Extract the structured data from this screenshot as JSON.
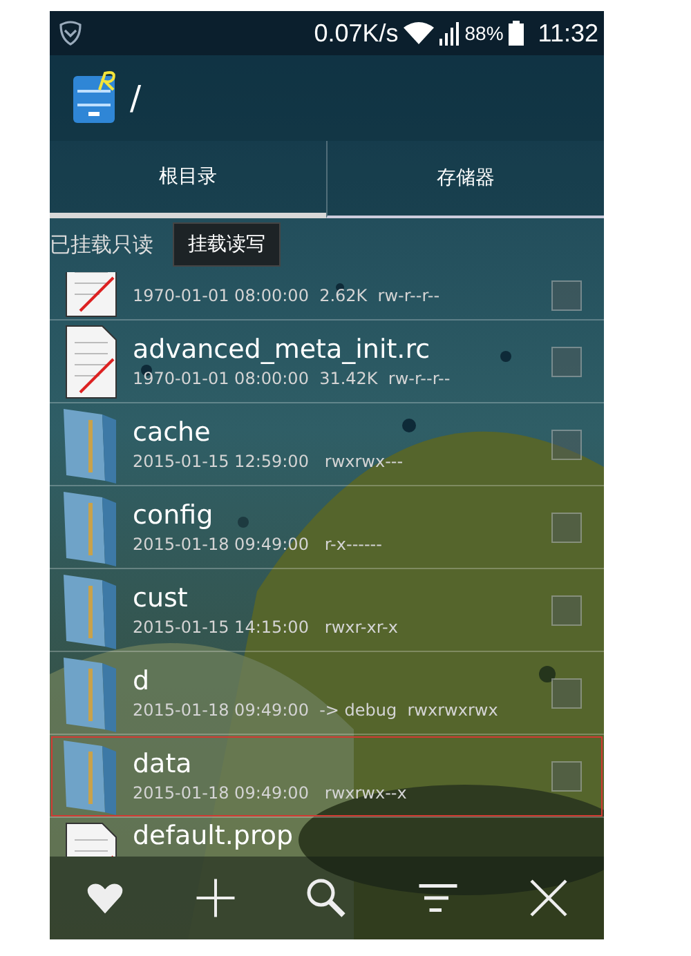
{
  "status_bar": {
    "speed": "0.07K/s",
    "battery": "88%",
    "time": "11:32"
  },
  "header": {
    "path": "/"
  },
  "tabs": [
    {
      "label": "根目录",
      "selected": true
    },
    {
      "label": "存储器",
      "selected": false
    }
  ],
  "mount": {
    "status": "已挂载只读",
    "action": "挂载读写"
  },
  "files": [
    {
      "kind": "file",
      "meta": "1970-01-01 08:00:00  2.62K  rw-r--r--",
      "checked": false,
      "highlighted": false
    },
    {
      "kind": "file",
      "name": "advanced_meta_init.rc",
      "meta": "1970-01-01 08:00:00  31.42K  rw-r--r--",
      "checked": false,
      "highlighted": false
    },
    {
      "kind": "folder",
      "name": "cache",
      "meta": "2015-01-15 12:59:00   rwxrwx---",
      "checked": false,
      "highlighted": false
    },
    {
      "kind": "folder",
      "name": "config",
      "meta": "2015-01-18 09:49:00   r-x------",
      "checked": false,
      "highlighted": false
    },
    {
      "kind": "folder",
      "name": "cust",
      "meta": "2015-01-15 14:15:00   rwxr-xr-x",
      "checked": false,
      "highlighted": false
    },
    {
      "kind": "folder",
      "name": "d",
      "meta": "2015-01-18 09:49:00  -> debug  rwxrwxrwx",
      "checked": false,
      "highlighted": false
    },
    {
      "kind": "folder",
      "name": "data",
      "meta": "2015-01-18 09:49:00   rwxrwx--x",
      "checked": false,
      "highlighted": true
    },
    {
      "kind": "file",
      "name": "default.prop"
    }
  ]
}
